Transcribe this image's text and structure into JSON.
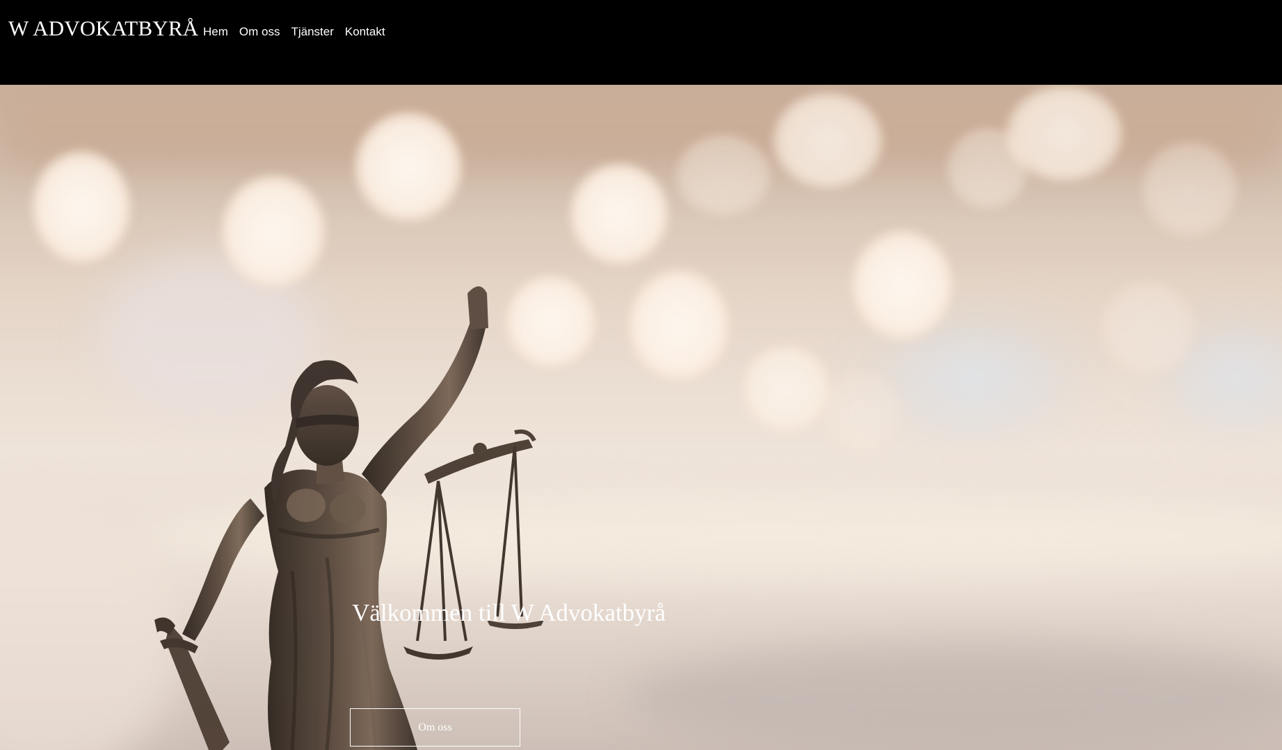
{
  "header": {
    "logo_text": "W ADVOKATBYRÅ",
    "nav": [
      {
        "label": "Hem"
      },
      {
        "label": "Om oss"
      },
      {
        "label": "Tjänster"
      },
      {
        "label": "Kontakt"
      }
    ]
  },
  "hero": {
    "image": "justitia-statue-scales-bokeh-photo",
    "title": "Välkommen till W Advokatbyrå",
    "button_label": "Om oss"
  },
  "colors": {
    "header_bg": "#000000",
    "text": "#ffffff",
    "statue_bronze": "#4a3d33",
    "bokeh_light": "#fbf1e6"
  }
}
